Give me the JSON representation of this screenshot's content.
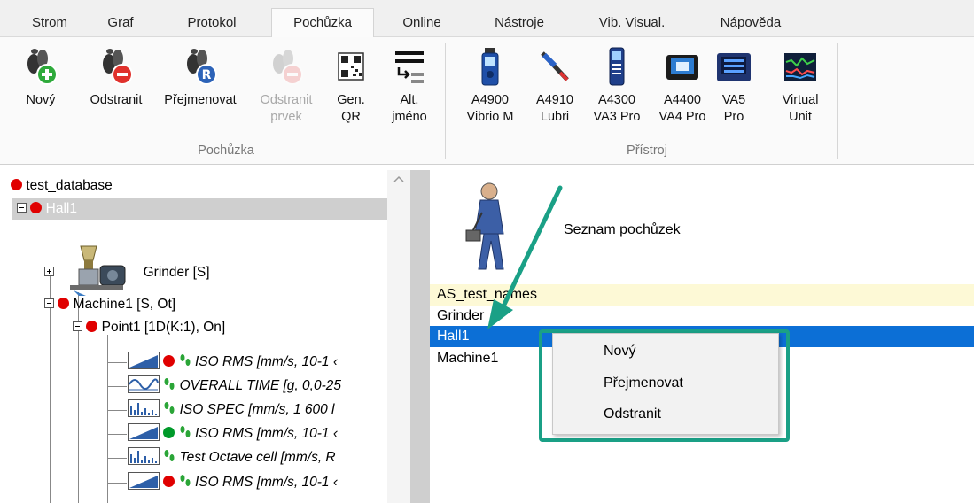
{
  "tabs": [
    {
      "label": "Strom",
      "active": false
    },
    {
      "label": "Graf",
      "active": false
    },
    {
      "label": "Protokol",
      "active": false
    },
    {
      "label": "Pochůzka",
      "active": true
    },
    {
      "label": "Online",
      "active": false
    },
    {
      "label": "Nástroje",
      "active": false
    },
    {
      "label": "Vib. Visual.",
      "active": false
    },
    {
      "label": "Nápověda",
      "active": false
    }
  ],
  "ribbon": {
    "route_group": {
      "label": "Pochůzka",
      "buttons": [
        {
          "label1": "Nový",
          "label2": "",
          "icon": "footprints-add-icon",
          "enabled": true
        },
        {
          "label1": "Odstranit",
          "label2": "",
          "icon": "footprints-remove-icon",
          "enabled": true
        },
        {
          "label1": "Přejmenovat",
          "label2": "",
          "icon": "footprints-rename-icon",
          "enabled": true
        },
        {
          "label1": "Odstranit",
          "label2": "prvek",
          "icon": "footprints-remove-item-icon",
          "enabled": false
        },
        {
          "label1": "Gen.",
          "label2": "QR",
          "icon": "qr-code-icon",
          "enabled": true
        },
        {
          "label1": "Alt.",
          "label2": "jméno",
          "icon": "alt-name-icon",
          "enabled": true
        }
      ]
    },
    "device_group": {
      "label": "Přístroj",
      "buttons": [
        {
          "label1": "A4900",
          "label2": "Vibrio M",
          "icon": "vibrio-device-icon"
        },
        {
          "label1": "A4910",
          "label2": "Lubri",
          "icon": "lubri-device-icon"
        },
        {
          "label1": "A4300",
          "label2": "VA3 Pro",
          "icon": "va3-device-icon"
        },
        {
          "label1": "A4400",
          "label2": "VA4 Pro",
          "icon": "va4-device-icon"
        },
        {
          "label1": "VA5",
          "label2": "Pro",
          "icon": "va5-device-icon"
        },
        {
          "label1": "Virtual",
          "label2": "Unit",
          "icon": "virtual-unit-icon"
        }
      ]
    }
  },
  "tree": {
    "database": "test_database",
    "hall": "Hall1",
    "grinder": "Grinder [S]",
    "machine": "Machine1 [S, Ot]",
    "point": "Point1 [1D(K:1), On]",
    "cells": [
      {
        "label": "ISO RMS [mm/s, 10-1 ‹",
        "status": "red"
      },
      {
        "label": "OVERALL TIME [g, 0,0-25",
        "status": "none"
      },
      {
        "label": "ISO SPEC [mm/s, 1 600 l",
        "status": "none"
      },
      {
        "label": "ISO RMS [mm/s, 10-1 ‹",
        "status": "green"
      },
      {
        "label": "Test Octave cell [mm/s, R",
        "status": "none"
      },
      {
        "label": "ISO RMS [mm/s, 10-1 ‹",
        "status": "red"
      }
    ]
  },
  "routes": {
    "title": "Seznam pochůzek",
    "items": [
      {
        "label": "AS_test_names",
        "state": "highlight"
      },
      {
        "label": "Grinder",
        "state": "normal"
      },
      {
        "label": "Hall1",
        "state": "selected"
      },
      {
        "label": "Machine1",
        "state": "normal"
      }
    ]
  },
  "context_menu": {
    "items": [
      "Nový",
      "Přejmenovat",
      "Odstranit"
    ]
  },
  "colors": {
    "selection": "#0c6fd6",
    "highlight_row": "#fdf9d6",
    "annotation": "#1aa086",
    "status_red": "#e00000",
    "status_green": "#009a2a"
  }
}
